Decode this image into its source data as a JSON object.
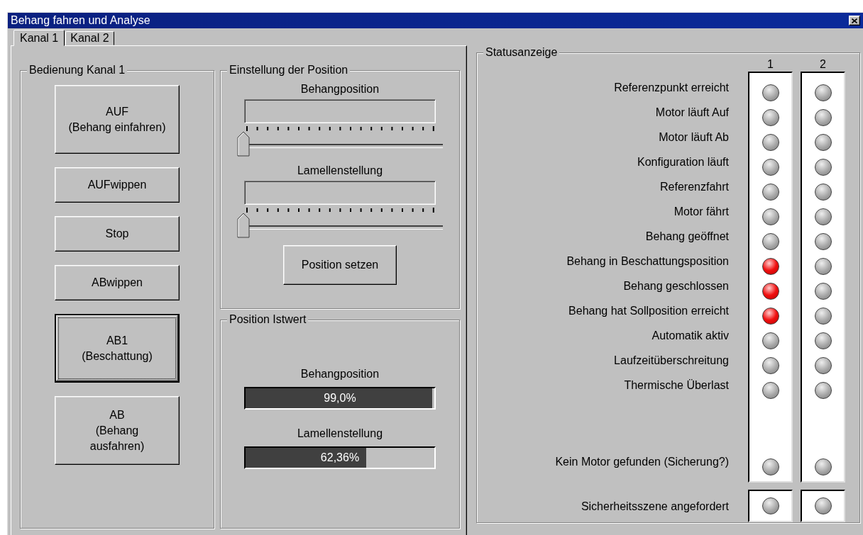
{
  "window": {
    "title": "Behang fahren und Analyse"
  },
  "tabs": [
    {
      "label": "Kanal 1",
      "selected": true
    },
    {
      "label": "Kanal 2",
      "selected": false
    }
  ],
  "control_group": {
    "title": "Bedienung Kanal 1",
    "buttons": [
      {
        "label": "AUF\n(Behang einfahren)",
        "focused": false
      },
      {
        "label": "AUFwippen",
        "focused": false
      },
      {
        "label": "Stop",
        "focused": false
      },
      {
        "label": "ABwippen",
        "focused": false
      },
      {
        "label": "AB1\n(Beschattung)",
        "focused": true
      },
      {
        "label": "AB\n(Behang\nausfahren)",
        "focused": false
      }
    ]
  },
  "setpoint_group": {
    "title": "Einstellung der Position",
    "sliders": [
      {
        "label": "Behangposition",
        "level": 0
      },
      {
        "label": "Lamellenstellung",
        "level": 0
      }
    ],
    "button": "Position setzen"
  },
  "actual_group": {
    "title": "Position Istwert",
    "bars": [
      {
        "label": "Behangposition",
        "level": 0.99,
        "reading": "99,0%"
      },
      {
        "label": "Lamellenstellung",
        "level": 0.64,
        "reading": "62,36%"
      }
    ]
  },
  "status": {
    "title": "Statusanzeige",
    "columns": [
      "1",
      "2"
    ],
    "rows": [
      {
        "label": "Referenzpunkt erreicht",
        "leds": [
          {
            "on": false
          },
          {
            "on": false
          }
        ]
      },
      {
        "label": "Motor läuft Auf",
        "leds": [
          {
            "on": false
          },
          {
            "on": false
          }
        ]
      },
      {
        "label": "Motor läuft Ab",
        "leds": [
          {
            "on": false
          },
          {
            "on": false
          }
        ]
      },
      {
        "label": "Konfiguration läuft",
        "leds": [
          {
            "on": false
          },
          {
            "on": false
          }
        ]
      },
      {
        "label": "Referenzfahrt",
        "leds": [
          {
            "on": false
          },
          {
            "on": false
          }
        ]
      },
      {
        "label": "Motor fährt",
        "leds": [
          {
            "on": false
          },
          {
            "on": false
          }
        ]
      },
      {
        "label": "Behang geöffnet",
        "leds": [
          {
            "on": false
          },
          {
            "on": false
          }
        ]
      },
      {
        "label": "Behang in Beschattungsposition",
        "leds": [
          {
            "on": true
          },
          {
            "on": false
          }
        ]
      },
      {
        "label": "Behang geschlossen",
        "leds": [
          {
            "on": true
          },
          {
            "on": false
          }
        ]
      },
      {
        "label": "Behang hat Sollposition erreicht",
        "leds": [
          {
            "on": true
          },
          {
            "on": false
          }
        ]
      },
      {
        "label": "Automatik aktiv",
        "leds": [
          {
            "on": false
          },
          {
            "on": false
          }
        ]
      },
      {
        "label": "Laufzeitüberschreitung",
        "leds": [
          {
            "on": false
          },
          {
            "on": false
          }
        ]
      },
      {
        "label": "Thermische Überlast",
        "leds": [
          {
            "on": false
          },
          {
            "on": false
          }
        ]
      },
      {
        "label": "Kein Motor gefunden (Sicherung?)",
        "leds": [
          {
            "on": false
          },
          {
            "on": false
          }
        ]
      }
    ],
    "safety_row": {
      "label": "Sicherheitsszene angefordert",
      "leds": [
        {
          "on": false
        },
        {
          "on": false
        }
      ]
    }
  }
}
